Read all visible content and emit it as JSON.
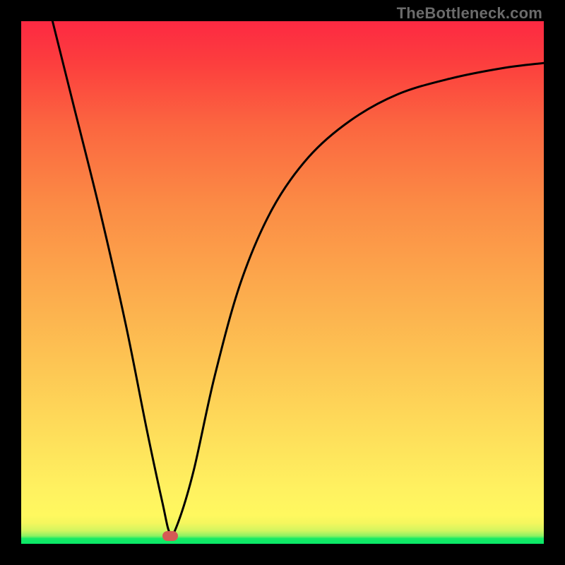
{
  "watermark": "TheBottleneck.com",
  "chart_data": {
    "type": "line",
    "title": "",
    "xlabel": "",
    "ylabel": "",
    "xlim": [
      0,
      100
    ],
    "ylim": [
      0,
      100
    ],
    "grid": false,
    "legend": false,
    "series": [
      {
        "name": "bottleneck-curve",
        "x": [
          6,
          10,
          15,
          20,
          24,
          27,
          28.5,
          30,
          33,
          37,
          42,
          48,
          55,
          63,
          72,
          82,
          92,
          100
        ],
        "y": [
          100,
          84,
          64,
          42,
          22,
          8,
          2,
          4,
          14,
          32,
          50,
          64,
          74,
          81,
          86,
          89,
          91,
          92
        ]
      }
    ],
    "annotations": [
      {
        "name": "min-marker",
        "x": 28.5,
        "y": 1.5
      }
    ],
    "background_gradient": [
      {
        "pos": 0.0,
        "color": "#09e868"
      },
      {
        "pos": 0.01,
        "color": "#17ea64"
      },
      {
        "pos": 0.015,
        "color": "#8cf162"
      },
      {
        "pos": 0.025,
        "color": "#d1f560"
      },
      {
        "pos": 0.04,
        "color": "#f5f65e"
      },
      {
        "pos": 0.055,
        "color": "#fff85f"
      },
      {
        "pos": 0.1,
        "color": "#fff260"
      },
      {
        "pos": 0.2,
        "color": "#fee05b"
      },
      {
        "pos": 0.35,
        "color": "#fdc453"
      },
      {
        "pos": 0.5,
        "color": "#fca84c"
      },
      {
        "pos": 0.65,
        "color": "#fb8b45"
      },
      {
        "pos": 0.8,
        "color": "#fb6640"
      },
      {
        "pos": 0.92,
        "color": "#fc3e3e"
      },
      {
        "pos": 1.0,
        "color": "#fd2942"
      }
    ]
  }
}
